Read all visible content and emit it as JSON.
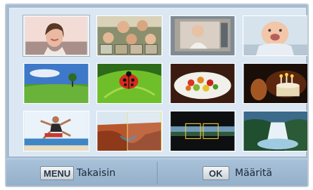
{
  "thumbnails": [
    {
      "name": "thumb-woman-portrait",
      "subject": "smiling woman portrait"
    },
    {
      "name": "thumb-group-faces",
      "subject": "group of faces collage"
    },
    {
      "name": "thumb-child-photos",
      "subject": "child photo stack"
    },
    {
      "name": "thumb-baby",
      "subject": "laughing baby"
    },
    {
      "name": "thumb-landscape-field",
      "subject": "green field with tree"
    },
    {
      "name": "thumb-ladybug",
      "subject": "ladybug on leaf"
    },
    {
      "name": "thumb-food-plate",
      "subject": "plate of vegetables"
    },
    {
      "name": "thumb-birthday-cake",
      "subject": "birthday cake candles"
    },
    {
      "name": "thumb-jumping-person",
      "subject": "person jumping at beach"
    },
    {
      "name": "thumb-canyon-panorama",
      "subject": "canyon panorama"
    },
    {
      "name": "thumb-panorama-frames",
      "subject": "panorama frame guides"
    },
    {
      "name": "thumb-waterfall",
      "subject": "waterfall"
    }
  ],
  "footer": {
    "back_key": "MENU",
    "back_label": "Takaisin",
    "ok_key": "OK",
    "ok_label": "Määritä"
  }
}
